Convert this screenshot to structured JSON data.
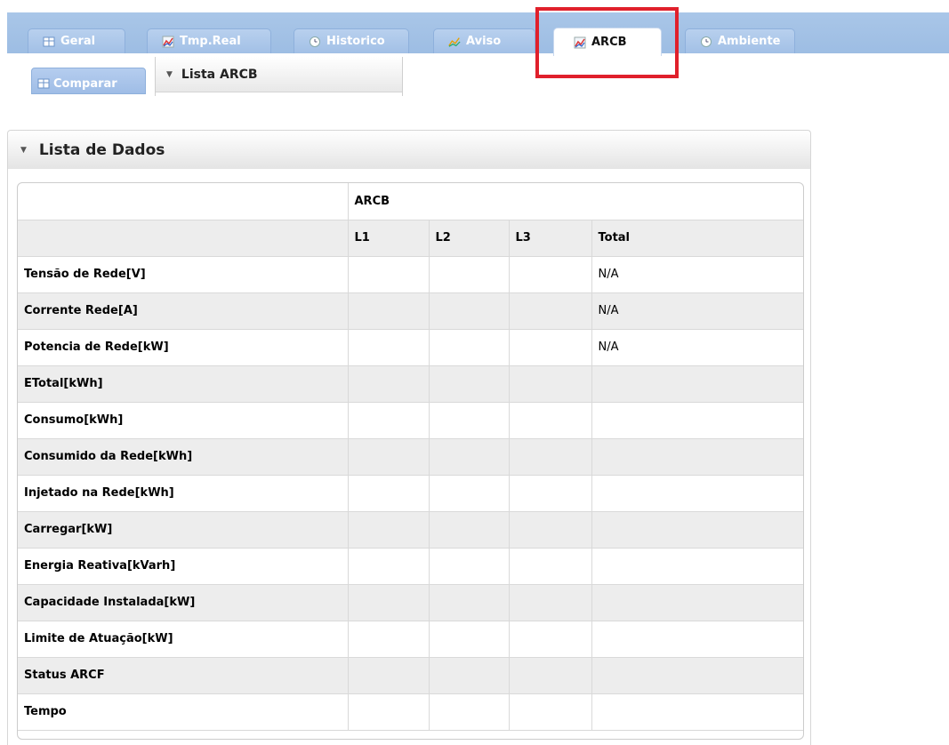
{
  "tabs": [
    {
      "label": "Geral",
      "icon": "grid-icon"
    },
    {
      "label": "Tmp.Real",
      "icon": "chart-icon"
    },
    {
      "label": "Historico",
      "icon": "clock-icon"
    },
    {
      "label": "Aviso",
      "icon": "warning-chart-icon"
    },
    {
      "label": "ARCB",
      "icon": "chart-icon",
      "active": true
    },
    {
      "label": "Ambiente",
      "icon": "clock-icon"
    }
  ],
  "subtab": {
    "label": "Comparar",
    "icon": "grid-icon"
  },
  "sublist": {
    "label": "Lista ARCB"
  },
  "panel": {
    "title": "Lista de Dados"
  },
  "table": {
    "group_header": "ARCB",
    "columns": [
      "L1",
      "L2",
      "L3",
      "Total"
    ],
    "rows": [
      {
        "label": "Tensão de Rede[V]",
        "values": [
          "",
          "",
          "",
          "N/A"
        ]
      },
      {
        "label": "Corrente Rede[A]",
        "values": [
          "",
          "",
          "",
          "N/A"
        ]
      },
      {
        "label": "Potencia de Rede[kW]",
        "values": [
          "",
          "",
          "",
          "N/A"
        ]
      },
      {
        "label": "ETotal[kWh]",
        "values": [
          "",
          "",
          "",
          ""
        ]
      },
      {
        "label": "Consumo[kWh]",
        "values": [
          "",
          "",
          "",
          ""
        ]
      },
      {
        "label": "Consumido da Rede[kWh]",
        "values": [
          "",
          "",
          "",
          ""
        ]
      },
      {
        "label": "Injetado na Rede[kWh]",
        "values": [
          "",
          "",
          "",
          ""
        ]
      },
      {
        "label": "Carregar[kW]",
        "values": [
          "",
          "",
          "",
          ""
        ]
      },
      {
        "label": "Energia Reativa[kVarh]",
        "values": [
          "",
          "",
          "",
          ""
        ]
      },
      {
        "label": "Capacidade Instalada[kW]",
        "values": [
          "",
          "",
          "",
          ""
        ]
      },
      {
        "label": "Limite de Atuação[kW]",
        "values": [
          "",
          "",
          "",
          ""
        ]
      },
      {
        "label": "Status ARCF",
        "values": [
          "",
          "",
          "",
          ""
        ]
      },
      {
        "label": "Tempo",
        "values": [
          "",
          "",
          "",
          ""
        ]
      }
    ]
  },
  "colors": {
    "tabbar": "#a9c6e8",
    "highlight": "#e0202b",
    "row_shade": "#ededed"
  }
}
